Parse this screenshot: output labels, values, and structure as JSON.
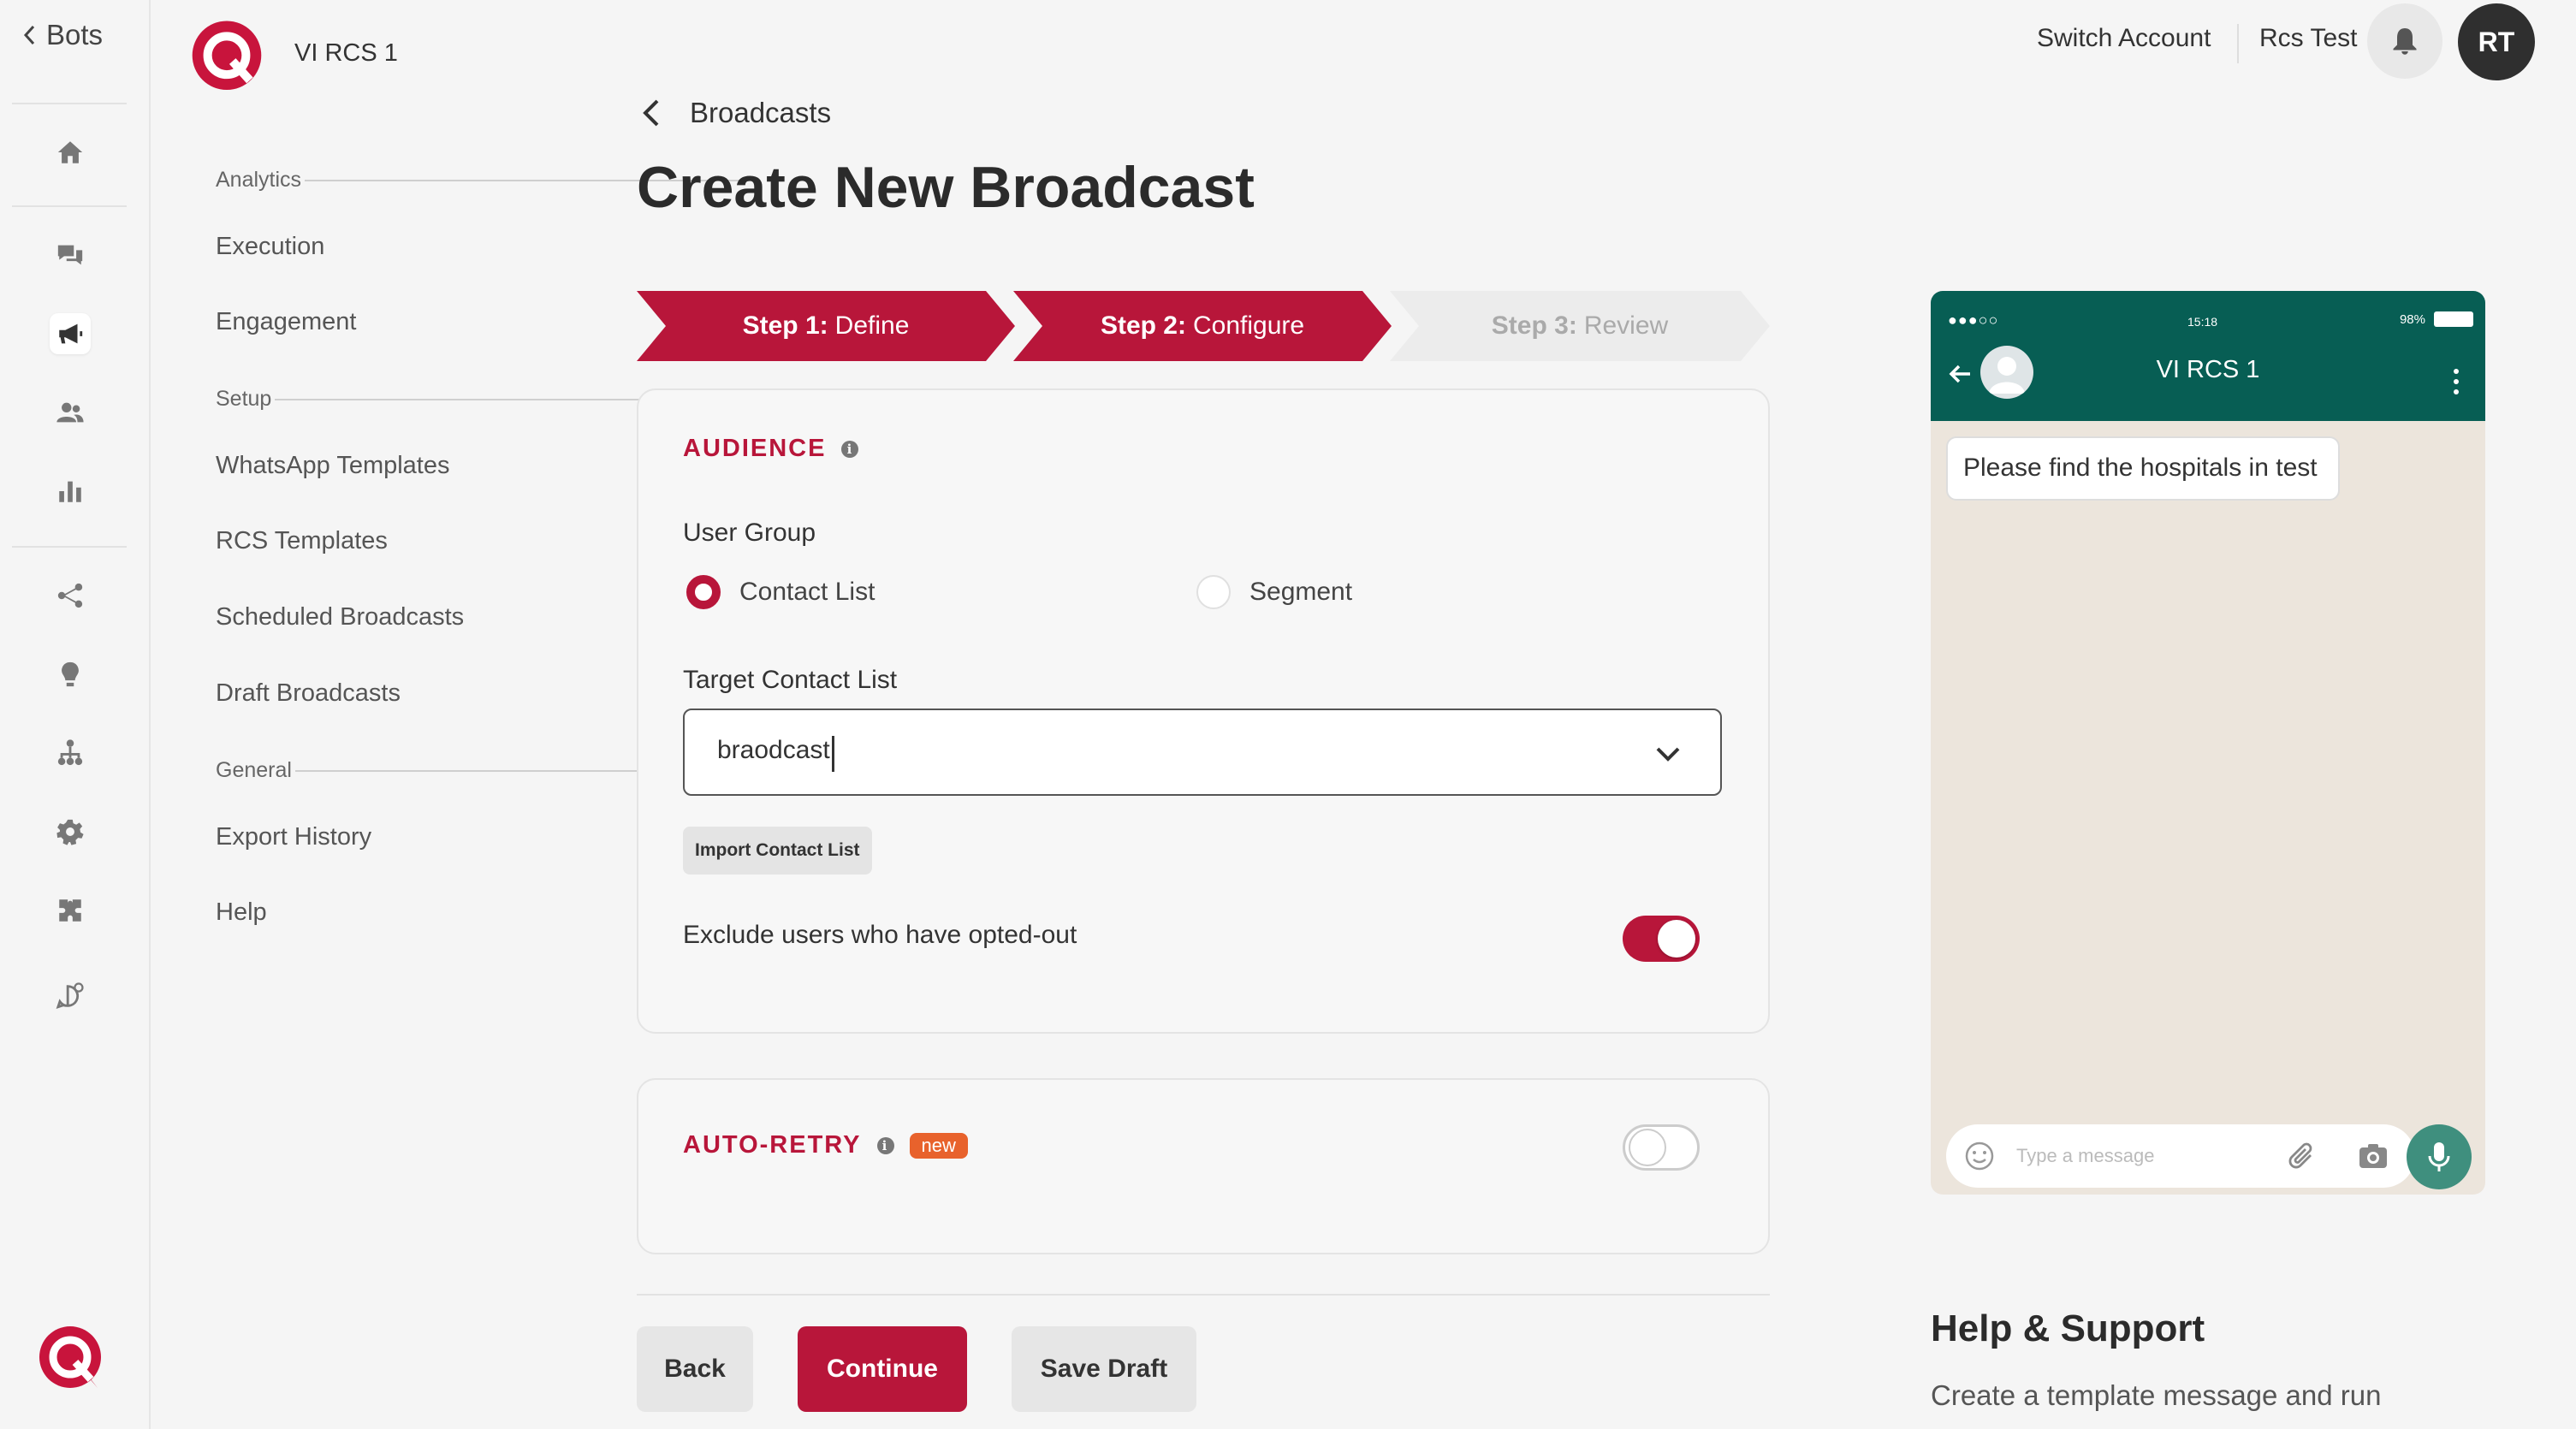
{
  "rail": {
    "back_label": "Bots",
    "icons": [
      "home-icon",
      "chat-icon",
      "megaphone-icon",
      "users-icon",
      "bar-chart-icon",
      "flow-icon",
      "bulb-icon",
      "hierarchy-icon",
      "gear-icon",
      "puzzle-icon",
      "whatsapp-settings-icon"
    ],
    "active": "megaphone-icon"
  },
  "subnav": {
    "bot_name": "VI RCS 1",
    "groups": [
      {
        "title": "Analytics",
        "items": [
          "Execution",
          "Engagement"
        ]
      },
      {
        "title": "Setup",
        "items": [
          "WhatsApp Templates",
          "RCS Templates",
          "Scheduled Broadcasts",
          "Draft Broadcasts"
        ]
      },
      {
        "title": "General",
        "items": [
          "Export History",
          "Help"
        ]
      }
    ]
  },
  "topbar": {
    "switch_account": "Switch Account",
    "account_name": "Rcs Test",
    "avatar_initials": "RT"
  },
  "main": {
    "breadcrumb": "Broadcasts",
    "title": "Create New Broadcast",
    "steps": [
      {
        "prefix": "Step 1:",
        "label": "Define",
        "state": "done"
      },
      {
        "prefix": "Step 2:",
        "label": "Configure",
        "state": "done"
      },
      {
        "prefix": "Step 3:",
        "label": "Review",
        "state": "todo"
      }
    ],
    "audience": {
      "title": "AUDIENCE",
      "user_group_label": "User Group",
      "options": [
        "Contact List",
        "Segment"
      ],
      "selected": "Contact List",
      "target_label": "Target Contact List",
      "target_value": "braodcast",
      "import_label": "Import Contact List",
      "exclude_label": "Exclude users who have opted-out",
      "exclude_on": true
    },
    "auto_retry": {
      "title": "AUTO-RETRY",
      "badge": "new",
      "enabled": false
    },
    "buttons": {
      "back": "Back",
      "continue": "Continue",
      "save_draft": "Save Draft"
    }
  },
  "preview": {
    "signal": "●●●○○",
    "time": "15:18",
    "battery": "98%",
    "contact_name": "VI RCS 1",
    "message": "Please find the hospitals in test",
    "input_placeholder": "Type a message"
  },
  "help": {
    "title": "Help & Support",
    "text": "Create a template message and run"
  },
  "colors": {
    "brand": "#b8163a",
    "whatsapp_header": "#075e54",
    "chat_bg": "#ece5dc",
    "badge_new": "#e8622c"
  }
}
